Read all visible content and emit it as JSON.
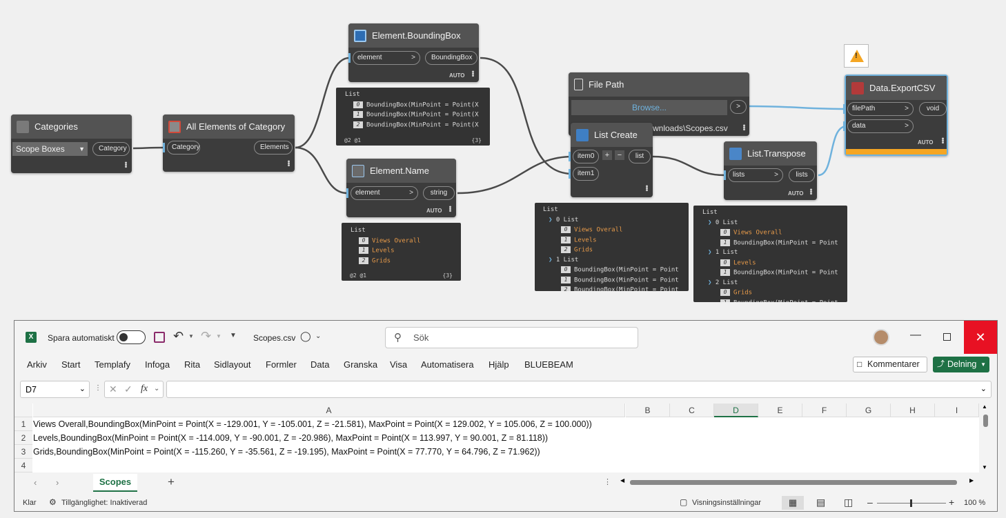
{
  "nodes": {
    "categories": {
      "title": "Categories",
      "dropdown": "Scope Boxes",
      "out": "Category"
    },
    "all_elements": {
      "title": "All Elements of Category",
      "in": "Category",
      "out": "Elements"
    },
    "bbox": {
      "title": "Element.BoundingBox",
      "in": "element",
      "out": "BoundingBox",
      "lacing": "AUTO"
    },
    "name": {
      "title": "Element.Name",
      "in": "element",
      "out": "string",
      "lacing": "AUTO"
    },
    "filepath": {
      "title": "File Path",
      "button": "Browse...",
      "path_text": "wnloads\\Scopes.csv"
    },
    "listcreate": {
      "title": "List Create",
      "in0": "item0",
      "in1": "item1",
      "out": "list",
      "plus": "+",
      "minus": "−"
    },
    "transpose": {
      "title": "List.Transpose",
      "in": "lists",
      "out": "lists",
      "lacing": "AUTO"
    },
    "export": {
      "title": "Data.ExportCSV",
      "in0": "filePath",
      "in1": "data",
      "out": "void",
      "lacing": "AUTO",
      "warning": "!"
    }
  },
  "previews": {
    "bbox": {
      "header": "List",
      "rows": [
        {
          "i": "0",
          "t": "BoundingBox(MinPoint = Point(X"
        },
        {
          "i": "1",
          "t": "BoundingBox(MinPoint = Point(X"
        },
        {
          "i": "2",
          "t": "BoundingBox(MinPoint = Point(X"
        }
      ],
      "levels": "@2 @1",
      "count": "{3}"
    },
    "name": {
      "header": "List",
      "rows": [
        {
          "i": "0",
          "t": "Views Overall"
        },
        {
          "i": "1",
          "t": "Levels"
        },
        {
          "i": "2",
          "t": "Grids"
        }
      ],
      "levels": "@2 @1",
      "count": "{3}"
    },
    "listcreate": {
      "header": "List",
      "g0": "0 List",
      "g0rows": [
        {
          "i": "0",
          "t": "Views Overall"
        },
        {
          "i": "1",
          "t": "Levels"
        },
        {
          "i": "2",
          "t": "Grids"
        }
      ],
      "g1": "1 List",
      "g1rows": [
        {
          "i": "0",
          "t": "BoundingBox(MinPoint = Point"
        },
        {
          "i": "1",
          "t": "BoundingBox(MinPoint = Point"
        },
        {
          "i": "2",
          "t": "BoundingBox(MinPoint = Point"
        }
      ]
    },
    "transpose": {
      "header": "List",
      "g0": "0 List",
      "g0rows": [
        {
          "i": "0",
          "t": "Views Overall"
        },
        {
          "i": "1",
          "t": "BoundingBox(MinPoint = Point"
        }
      ],
      "g1": "1 List",
      "g1rows": [
        {
          "i": "0",
          "t": "Levels"
        },
        {
          "i": "1",
          "t": "BoundingBox(MinPoint = Point"
        }
      ],
      "g2": "2 List",
      "g2rows": [
        {
          "i": "0",
          "t": "Grids"
        },
        {
          "i": "1",
          "t": "BoundingBox(MinPoint = Point"
        }
      ]
    }
  },
  "excel": {
    "autosave": "Spara automatiskt",
    "filename": "Scopes.csv",
    "search_placeholder": "Sök",
    "menu": [
      "Arkiv",
      "Start",
      "Templafy",
      "Infoga",
      "Rita",
      "Sidlayout",
      "Formler",
      "Data",
      "Granska",
      "Visa",
      "Automatisera",
      "Hjälp",
      "BLUEBEAM"
    ],
    "comments": "Kommentarer",
    "share": "Delning",
    "namebox": "D7",
    "fx": "fx",
    "columns": [
      "A",
      "B",
      "C",
      "D",
      "E",
      "F",
      "G",
      "H",
      "I"
    ],
    "rows": [
      {
        "n": "1",
        "a": "Views Overall,BoundingBox(MinPoint = Point(X = -129.001, Y = -105.001, Z = -21.581), MaxPoint = Point(X = 129.002, Y = 105.006, Z = 100.000))"
      },
      {
        "n": "2",
        "a": "Levels,BoundingBox(MinPoint = Point(X = -114.009, Y = -90.001, Z = -20.986), MaxPoint = Point(X = 113.997, Y = 90.001, Z = 81.118))"
      },
      {
        "n": "3",
        "a": "Grids,BoundingBox(MinPoint = Point(X = -115.260, Y = -35.561, Z = -19.195), MaxPoint = Point(X = 77.770, Y = 64.796, Z = 71.962))"
      },
      {
        "n": "4",
        "a": ""
      }
    ],
    "sheet_tab": "Scopes",
    "status_ready": "Klar",
    "accessibility": "Tillgänglighet: Inaktiverad",
    "view_settings": "Visningsinställningar",
    "zoom": "100 %"
  },
  "colors": {
    "excel_green": "#1e7145",
    "close_red": "#e81123",
    "port_blue": "#6fb2dd",
    "warning_orange": "#f5a623"
  }
}
